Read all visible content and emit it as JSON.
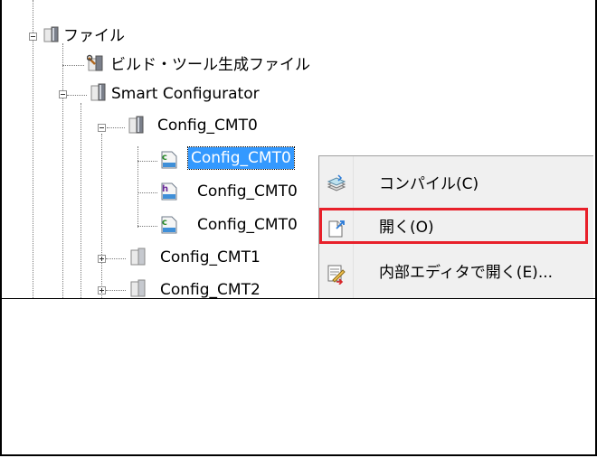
{
  "tree": {
    "nodes": [
      {
        "label": "ファイル",
        "icon": "folder-file-icon"
      },
      {
        "label": "ビルド・ツール生成ファイル",
        "icon": "build-tool-icon"
      },
      {
        "label": "Smart Configurator",
        "icon": "folder-icon"
      },
      {
        "label": "Config_CMT0",
        "icon": "folder-icon"
      },
      {
        "label": "Config_CMT0",
        "icon": "c-source-file-icon",
        "selected": true
      },
      {
        "label": "Config_CMT0",
        "icon": "h-header-file-icon"
      },
      {
        "label": "Config_CMT0",
        "icon": "c-source-file-icon"
      },
      {
        "label": "Config_CMT1",
        "icon": "folder-icon"
      },
      {
        "label": "Config_CMT2",
        "icon": "folder-icon"
      }
    ]
  },
  "context_menu": {
    "items": [
      {
        "label": "コンパイル(C)",
        "icon": "compile-icon"
      },
      {
        "label": "開く(O)",
        "icon": "open-file-icon",
        "highlighted": true
      },
      {
        "label": "内部エディタで開く(E)...",
        "icon": "internal-editor-icon"
      }
    ]
  },
  "colors": {
    "selection": "#3399ff",
    "highlight_border": "#e8202a",
    "menu_background": "#f0f0f0"
  }
}
